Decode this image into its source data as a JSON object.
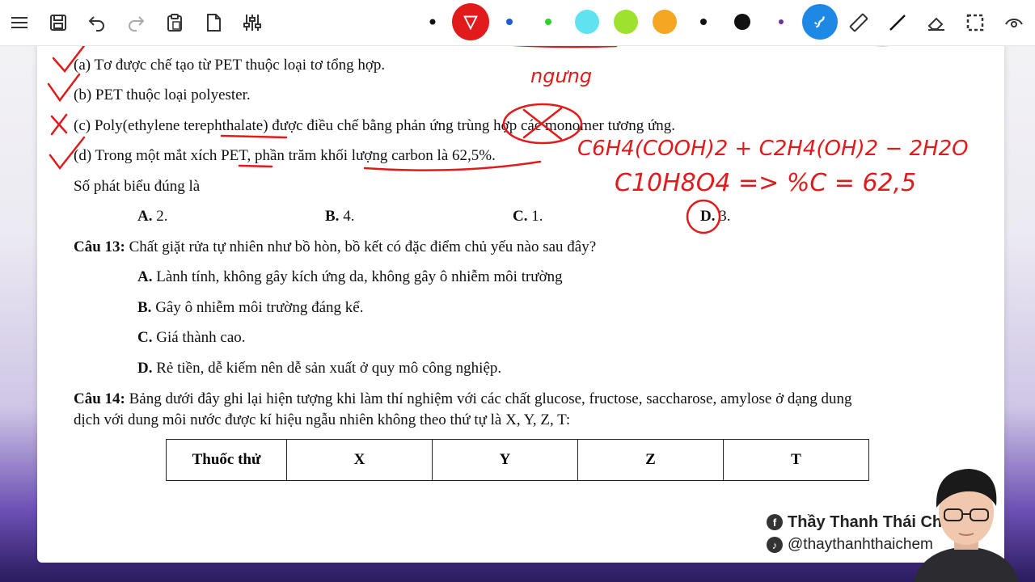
{
  "toolbar": {
    "tools": [
      {
        "icon": "menu-icon"
      },
      {
        "icon": "save-icon"
      },
      {
        "icon": "undo-icon"
      },
      {
        "icon": "redo-icon"
      },
      {
        "icon": "clipboard-icon"
      },
      {
        "icon": "new-page-icon"
      },
      {
        "icon": "sliders-icon"
      }
    ],
    "pen_colors": [
      "#111111",
      "#e11b1b",
      "#1e5bd6",
      "#2fd12f",
      "#5fe3f0",
      "#9ee22f",
      "#f5a623",
      "#111111",
      "#111111",
      "#6b2fa8"
    ],
    "right_tools": [
      "shape-pen-icon",
      "ruler-icon",
      "line-icon",
      "eraser-icon",
      "select-icon",
      "view-icon"
    ]
  },
  "doc": {
    "items": [
      {
        "id": "a",
        "text": "(a) Tơ được chế tạo từ PET thuộc loại tơ tổng hợp."
      },
      {
        "id": "b",
        "text": "(b) PET thuộc loại polyester."
      },
      {
        "id": "c",
        "text": "(c) Poly(ethylene terephthalate) được điều chế bằng phản ứng trùng hợp các monomer tương ứng."
      },
      {
        "id": "d",
        "text": "(d) Trong một mắt xích PET, phần trăm khối lượng carbon là 62,5%."
      }
    ],
    "prompt": "Số phát biểu đúng là",
    "q12_options": [
      {
        "letter": "A.",
        "text": " 2."
      },
      {
        "letter": "B.",
        "text": " 4."
      },
      {
        "letter": "C.",
        "text": " 1."
      },
      {
        "letter": "D.",
        "text": " 3."
      }
    ],
    "q13": {
      "label": "Câu 13:",
      "text": " Chất giặt rửa tự nhiên như bồ hòn, bồ kết có đặc điểm chủ yếu nào sau đây?",
      "options": [
        {
          "letter": "A.",
          "text": " Lành tính, không gây kích ứng da, không gây ô nhiễm môi trường"
        },
        {
          "letter": "B.",
          "text": " Gây ô nhiễm môi trường đáng kể."
        },
        {
          "letter": "C.",
          "text": " Giá thành cao."
        },
        {
          "letter": "D.",
          "text": " Rẻ tiền, dễ kiếm nên dễ sản xuất ở quy mô công nghiệp."
        }
      ]
    },
    "q14": {
      "label": "Câu 14:",
      "line1": " Bảng dưới đây ghi lại hiện tượng khi làm thí nghiệm với các chất glucose, fructose, saccharose, amylose ở dạng dung",
      "line2": "dịch với dung môi nước được kí hiệu ngẫu nhiên không theo thứ tự là X, Y, Z, T:",
      "table_headers": [
        "Thuốc thử",
        "X",
        "Y",
        "Z",
        "T"
      ]
    }
  },
  "handwriting": {
    "note1": "ngưng",
    "formula1": "C6H4(COOH)2 + C2H4(OH)2 − 2H2O",
    "formula2": "C10H8O4 => %C = 62,5"
  },
  "social": {
    "facebook": "Thầy Thanh Thái Ch",
    "tiktok": "@thaythanhthaichem"
  }
}
